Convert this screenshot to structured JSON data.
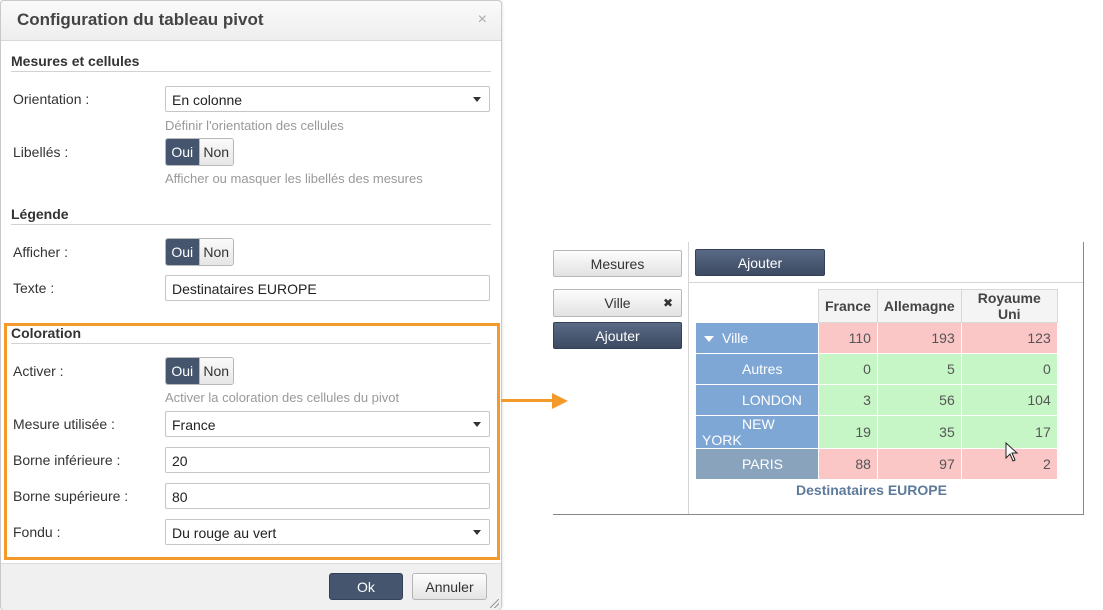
{
  "dialog": {
    "title": "Configuration du tableau pivot",
    "close_glyph": "×",
    "sections": {
      "measures": "Mesures et cellules",
      "legend": "Légende",
      "coloring": "Coloration"
    },
    "orientation": {
      "label": "Orientation :",
      "value": "En colonne",
      "help": "Définir l'orientation des cellules"
    },
    "labels": {
      "label": "Libellés :",
      "yes": "Oui",
      "no": "Non",
      "help": "Afficher ou masquer les libellés des mesures"
    },
    "legend_show": {
      "label": "Afficher :",
      "yes": "Oui",
      "no": "Non"
    },
    "legend_text": {
      "label": "Texte :",
      "value": "Destinataires EUROPE"
    },
    "activate": {
      "label": "Activer :",
      "yes": "Oui",
      "no": "Non",
      "help": "Activer la coloration des cellules du pivot"
    },
    "measure_used": {
      "label": "Mesure utilisée :",
      "value": "France"
    },
    "lower_bound": {
      "label": "Borne inférieure :",
      "value": "20"
    },
    "upper_bound": {
      "label": "Borne supérieure :",
      "value": "80"
    },
    "fade": {
      "label": "Fondu :",
      "value": "Du rouge au vert"
    },
    "ok_label": "Ok",
    "cancel_label": "Annuler",
    "highlight_color": "#f39a2b",
    "accent_color": "#45556e"
  },
  "pivot": {
    "measures_button": "Mesures",
    "add_top_button": "Ajouter",
    "ville_chip": "Ville",
    "chip_remove": "✖",
    "add_side_button": "Ajouter",
    "columns": [
      "France",
      "Allemagne",
      "Royaume Uni"
    ],
    "rows": [
      {
        "label": "Ville",
        "values": [
          "110",
          "193",
          "123"
        ],
        "colors": [
          "red",
          "red",
          "red"
        ]
      },
      {
        "label": "Autres",
        "values": [
          "0",
          "5",
          "0"
        ],
        "colors": [
          "green",
          "green",
          "green"
        ]
      },
      {
        "label": "LONDON",
        "values": [
          "3",
          "56",
          "104"
        ],
        "colors": [
          "green",
          "green",
          "green"
        ]
      },
      {
        "label": "NEW YORK",
        "values": [
          "19",
          "35",
          "17"
        ],
        "colors": [
          "green",
          "green",
          "green"
        ]
      },
      {
        "label": "PARIS",
        "values": [
          "88",
          "97",
          "2"
        ],
        "colors": [
          "red",
          "red",
          "red"
        ]
      }
    ],
    "caption": "Destinataires EUROPE",
    "low_color": "#fbc6c6",
    "high_color": "#c6f6c6"
  }
}
